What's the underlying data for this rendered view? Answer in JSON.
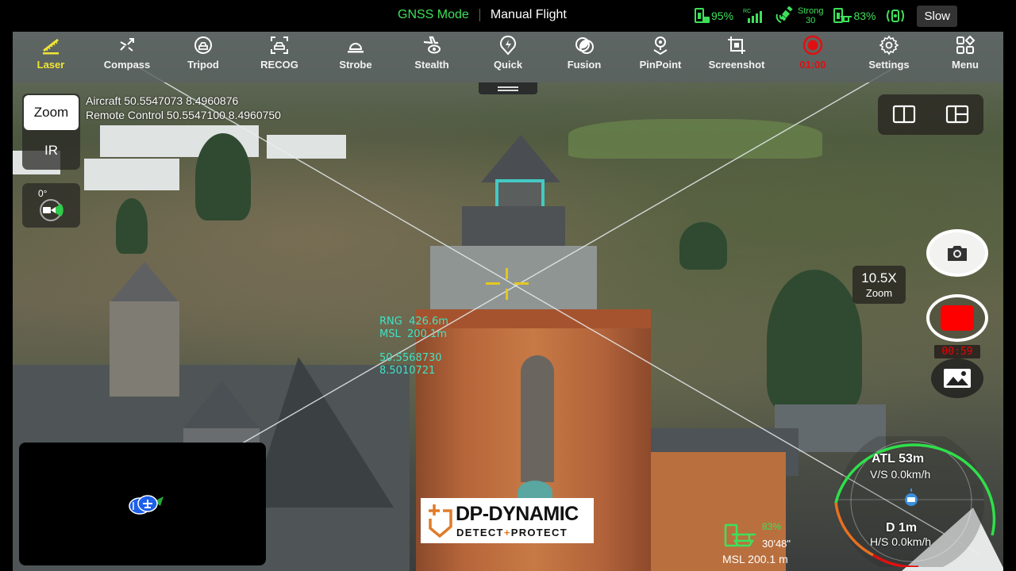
{
  "status_bar": {
    "positioning_mode": "GNSS Mode",
    "flight_mode": "Manual Flight",
    "rc_battery": "95%",
    "rc_signal_label": "RC",
    "gnss_strength": "Strong",
    "satellite_count": "30",
    "aircraft_battery": "83%",
    "speed_mode": "Slow",
    "colors": {
      "ok": "#3ee05a"
    }
  },
  "toolbar": {
    "items": [
      {
        "label": "Laser",
        "icon": "laser-ruler-icon",
        "active": true
      },
      {
        "label": "Compass",
        "icon": "compass-icon"
      },
      {
        "label": "Tripod",
        "icon": "tripod-icon"
      },
      {
        "label": "RECOG",
        "icon": "recognition-icon"
      },
      {
        "label": "Strobe",
        "icon": "strobe-icon"
      },
      {
        "label": "Stealth",
        "icon": "stealth-icon"
      },
      {
        "label": "Quick",
        "icon": "quick-icon"
      },
      {
        "label": "Fusion",
        "icon": "fusion-icon"
      },
      {
        "label": "PinPoint",
        "icon": "pinpoint-icon"
      },
      {
        "label": "Screenshot",
        "icon": "screenshot-icon"
      },
      {
        "label": "01:00",
        "icon": "record-indicator-icon",
        "recording": true
      },
      {
        "label": "Settings",
        "icon": "gear-icon"
      },
      {
        "label": "Menu",
        "icon": "menu-grid-icon"
      }
    ],
    "active_color": "#f1e533",
    "record_color": "#e01010"
  },
  "camera": {
    "lenses": [
      "Zoom",
      "IR"
    ],
    "selected_lens": "Zoom",
    "gimbal_pitch": "0°",
    "zoom_level": "10.5X",
    "zoom_label": "Zoom",
    "record_timer": "00:59"
  },
  "positions": {
    "aircraft": "Aircraft 50.5547073 8.4960876",
    "remote_control": "Remote Control 50.5547100 8.4960750"
  },
  "laser_target": {
    "range": "RNG  426.6m",
    "msl": "MSL  200.1m",
    "latitude": "50.5568730",
    "longitude": "8.5010721",
    "color": "#3fe3c6"
  },
  "flight_data": {
    "altitude": "ATL 53m",
    "vertical_speed": "V/S 0.0km/h",
    "distance": "D   1m",
    "horizontal_speed": "H/S 0.0km/h",
    "drone_battery": "83%",
    "heading": "30'48\"",
    "msl": "MSL 200.1 m"
  },
  "watermark": {
    "title": "DP-DYNAMIC",
    "sub_left": "DETECT",
    "sub_plus": "+",
    "sub_right": "PROTECT",
    "accent": "#e07b2a"
  }
}
